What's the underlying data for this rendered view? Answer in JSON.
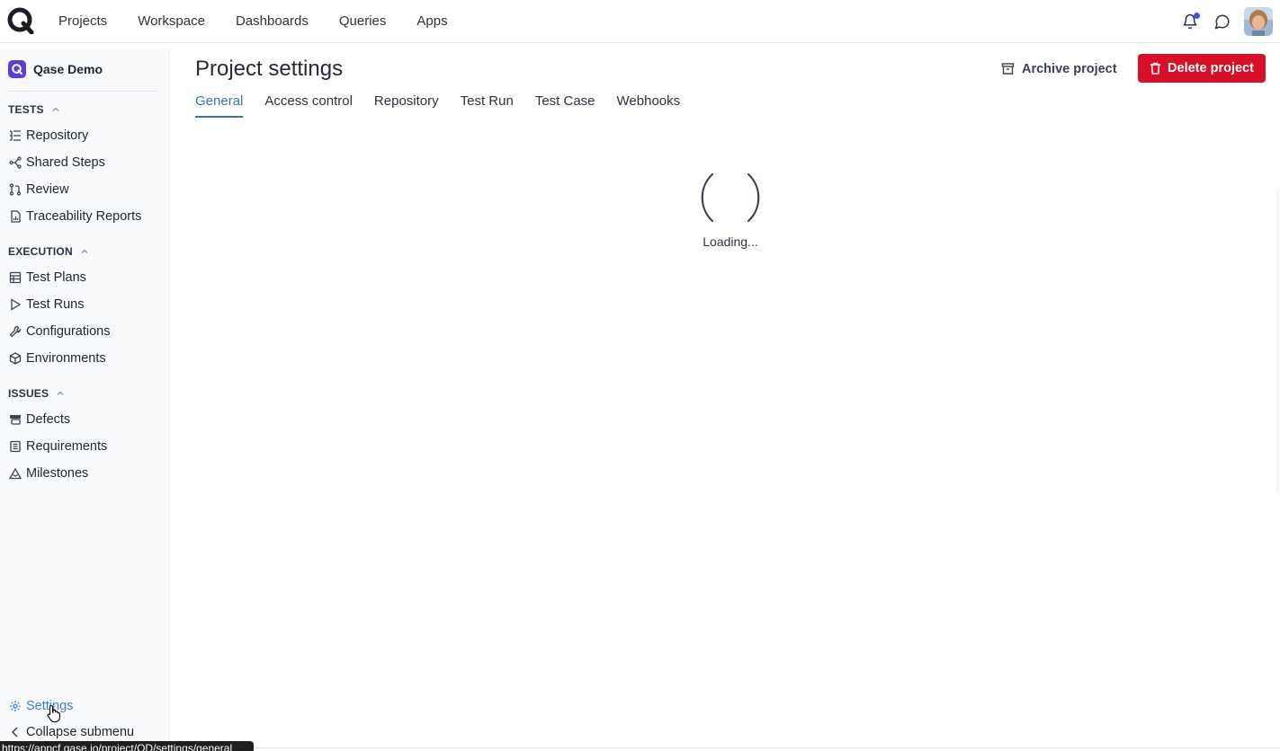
{
  "topnav": {
    "items": [
      "Projects",
      "Workspace",
      "Dashboards",
      "Queries",
      "Apps"
    ]
  },
  "topbar_icons": [
    "logo-icon",
    "bell-icon",
    "chat-icon",
    "avatar"
  ],
  "sidebar": {
    "project_name": "Qase Demo",
    "sections": [
      {
        "title": "TESTS",
        "items": [
          "Repository",
          "Shared Steps",
          "Review",
          "Traceability Reports"
        ]
      },
      {
        "title": "EXECUTION",
        "items": [
          "Test Plans",
          "Test Runs",
          "Configurations",
          "Environments"
        ]
      },
      {
        "title": "ISSUES",
        "items": [
          "Defects",
          "Requirements",
          "Milestones"
        ]
      }
    ],
    "settings_label": "Settings",
    "collapse_label": "Collapse submenu"
  },
  "main": {
    "title": "Project settings",
    "archive_label": "Archive project",
    "delete_label": "Delete project",
    "tabs": [
      "General",
      "Access control",
      "Repository",
      "Test Run",
      "Test Case",
      "Webhooks"
    ],
    "active_tab": "General",
    "loading_text": "Loading..."
  },
  "status_url": "https://appcf.qase.io/project/QD/settings/general",
  "colors": {
    "accent": "#3e6fb8",
    "danger": "#d70f27",
    "brand": "#5a3fd6",
    "notification": "#4b4df2"
  }
}
